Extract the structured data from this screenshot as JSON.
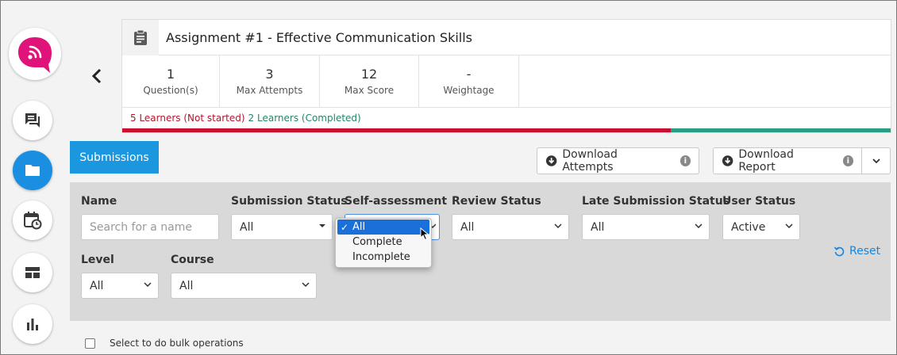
{
  "colors": {
    "accent": "#1b97df",
    "brand": "#e0137b",
    "not_started": "#c8102e",
    "completed": "#2a9d84",
    "link": "#1b84d8"
  },
  "sidebar": {
    "logo_icon": "speech-bubble-logo",
    "items": [
      {
        "icon": "chat-icon"
      },
      {
        "icon": "folder-icon",
        "active": true
      },
      {
        "icon": "calendar-clock-icon"
      },
      {
        "icon": "dashboard-icon"
      },
      {
        "icon": "bar-chart-icon"
      }
    ]
  },
  "assignment": {
    "title": "Assignment #1 - Effective Communication Skills",
    "stats": [
      {
        "value": "1",
        "label": "Question(s)"
      },
      {
        "value": "3",
        "label": "Max Attempts"
      },
      {
        "value": "12",
        "label": "Max Score"
      },
      {
        "value": "-",
        "label": "Weightage"
      }
    ],
    "not_started_text": "5 Learners (Not started)",
    "completed_text": "2 Learners (Completed)",
    "progress": {
      "not_started": 5,
      "completed": 2
    }
  },
  "tabs": {
    "submissions": "Submissions"
  },
  "toolbar": {
    "download_attempts": "Download Attempts",
    "download_report": "Download Report"
  },
  "filters": {
    "name_label": "Name",
    "name_placeholder": "Search for a name",
    "submission_status_label": "Submission Status",
    "submission_status_value": "All",
    "self_assessment_label": "Self-assessment",
    "self_assessment_options": [
      "All",
      "Complete",
      "Incomplete"
    ],
    "self_assessment_selected": "All",
    "review_status_label": "Review Status",
    "review_status_value": "All",
    "late_submission_label": "Late Submission Status",
    "late_submission_value": "All",
    "user_status_label": "User Status",
    "user_status_value": "Active",
    "level_label": "Level",
    "level_value": "All",
    "course_label": "Course",
    "course_value": "All",
    "reset_label": "Reset"
  },
  "bulk": {
    "label": "Select to do bulk operations"
  }
}
